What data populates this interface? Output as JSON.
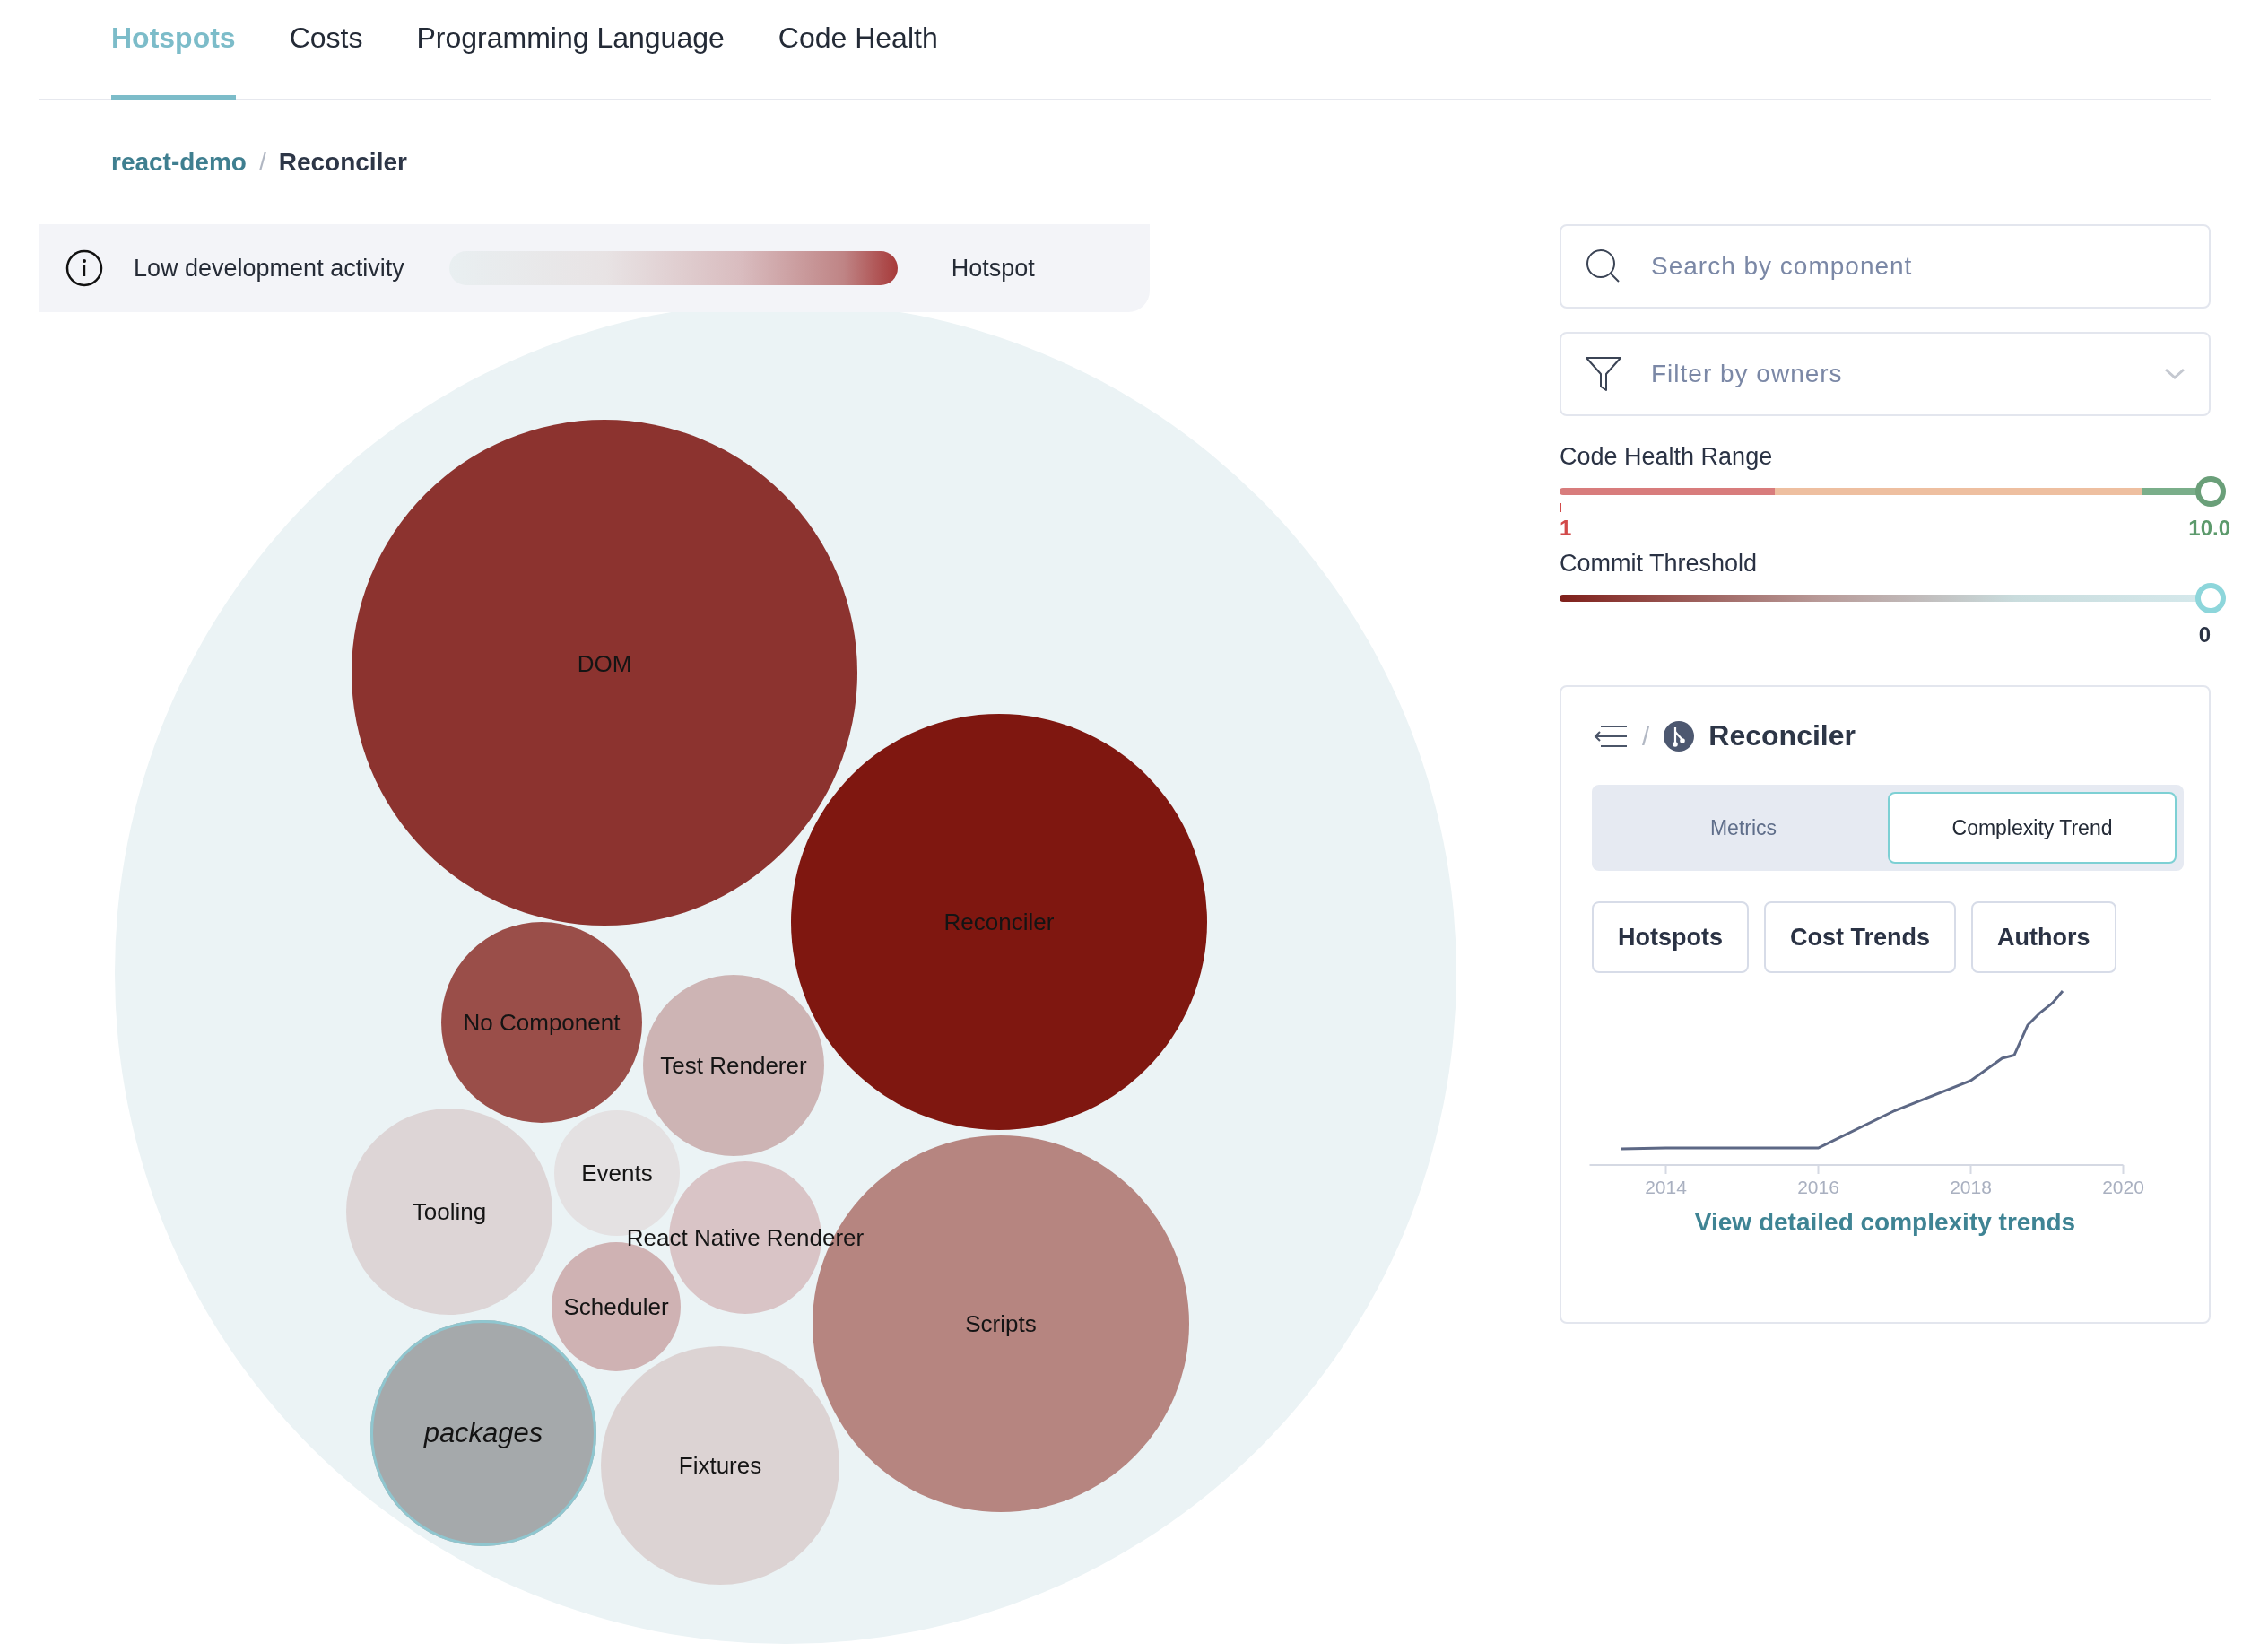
{
  "tabs": [
    {
      "label": "Hotspots",
      "selected": true
    },
    {
      "label": "Costs",
      "selected": false
    },
    {
      "label": "Programming Language",
      "selected": false
    },
    {
      "label": "Code Health",
      "selected": false
    }
  ],
  "breadcrumb": {
    "project": "react-demo",
    "separator": "/",
    "current": "Reconciler"
  },
  "legend": {
    "low_label": "Low development activity",
    "high_label": "Hotspot"
  },
  "components": [
    {
      "name": "DOM",
      "color": "#8c332f",
      "kind": "component"
    },
    {
      "name": "Reconciler",
      "color": "#7f1710",
      "kind": "component"
    },
    {
      "name": "No Component",
      "color": "#9a4e49",
      "kind": "component"
    },
    {
      "name": "Test Renderer",
      "color": "#cdb4b4",
      "kind": "component"
    },
    {
      "name": "Tooling",
      "color": "#ddd5d6",
      "kind": "component"
    },
    {
      "name": "Events",
      "color": "#e4e1e2",
      "kind": "component"
    },
    {
      "name": "React Native Renderer",
      "color": "#d9c4c6",
      "kind": "component"
    },
    {
      "name": "Scheduler",
      "color": "#cfb2b3",
      "kind": "component"
    },
    {
      "name": "packages",
      "color": "#a5a9ab",
      "kind": "folder"
    },
    {
      "name": "Fixtures",
      "color": "#dcd3d3",
      "kind": "component"
    },
    {
      "name": "Scripts",
      "color": "#b68580",
      "kind": "component"
    }
  ],
  "search": {
    "placeholder": "Search by component"
  },
  "owner_filter": {
    "placeholder": "Filter by owners"
  },
  "code_health": {
    "label": "Code Health Range",
    "level": 1,
    "min_reading": "1",
    "max_reading": "10.0"
  },
  "commit_threshold": {
    "label": "Commit Threshold",
    "level": 1,
    "reading": "0"
  },
  "detail": {
    "separator": "/",
    "title": "Reconciler",
    "views": [
      {
        "label": "Metrics",
        "selected": false
      },
      {
        "label": "Complexity Trend",
        "selected": true
      }
    ],
    "links": [
      "Hotspots",
      "Cost Trends",
      "Authors"
    ],
    "trend": {
      "x_labels": [
        "2014",
        "2016",
        "2018",
        "2020"
      ]
    },
    "footer_link": "View detailed complexity trends"
  }
}
